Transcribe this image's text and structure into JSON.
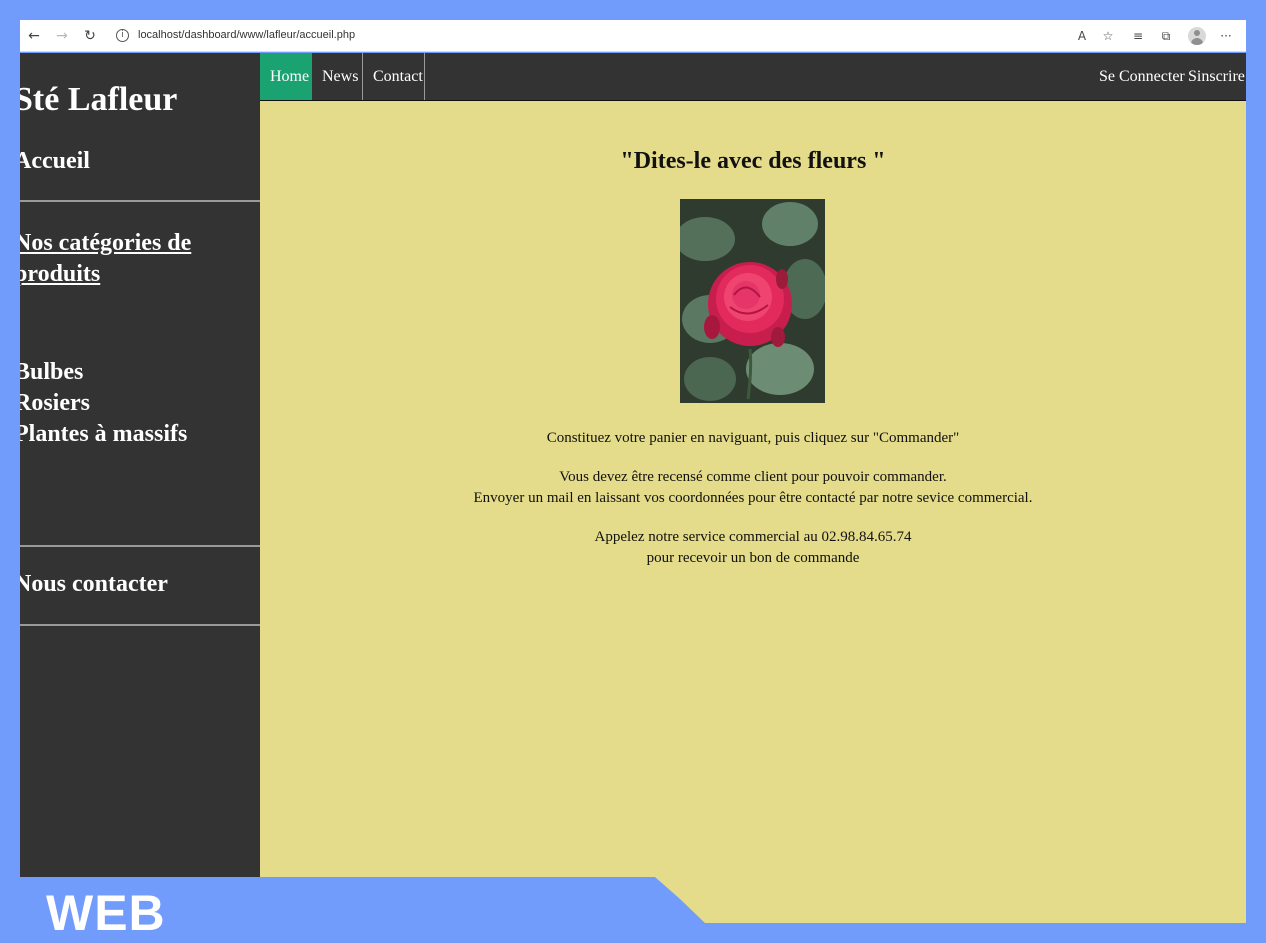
{
  "browser": {
    "url": "localhost/dashboard/www/lafleur/accueil.php"
  },
  "sidebar": {
    "brand": "Sté Lafleur",
    "home": "Accueil",
    "categories_title": "Nos catégories de produits",
    "categories": [
      "Bulbes",
      "Rosiers",
      "Plantes à massifs"
    ],
    "contact": "Nous contacter"
  },
  "topnav": {
    "home": "Home",
    "news": "News",
    "contact": "Contact",
    "login": "Se Connecter",
    "register": "Sinscrire"
  },
  "main": {
    "slogan": "\"Dites-le avec des fleurs \"",
    "cart_text": "Constituez votre panier en naviguant, puis cliquez sur \"Commander\"",
    "client_line1": "Vous devez être recensé comme client pour pouvoir commander.",
    "client_line2": "Envoyer un mail en laissant vos coordonnées pour être contacté par notre sevice commercial.",
    "call_line1": "Appelez notre service commercial au 02.98.84.65.74",
    "call_line2": "pour recevoir un bon de commande"
  },
  "footer": {
    "label": "WEB"
  },
  "colors": {
    "frame_blue": "#729cfc",
    "dark": "#333333",
    "active_green": "#1aa271",
    "content_bg": "#e4dc8a"
  }
}
